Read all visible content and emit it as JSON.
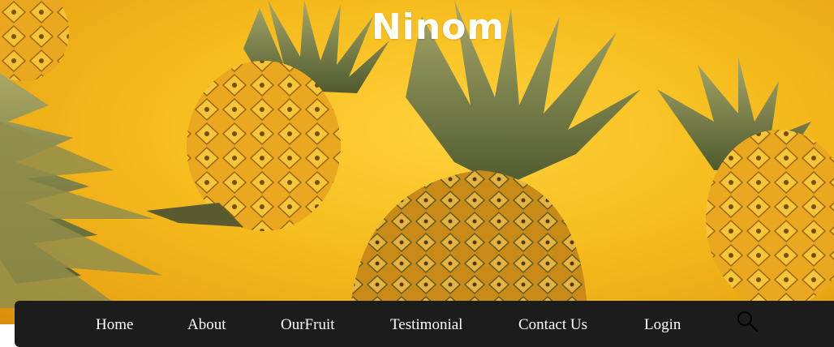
{
  "brand": {
    "title": "Ninom"
  },
  "nav": {
    "items": [
      {
        "label": "Home"
      },
      {
        "label": "About"
      },
      {
        "label": "OurFruit"
      },
      {
        "label": "Testimonial"
      },
      {
        "label": "Contact Us"
      },
      {
        "label": "Login"
      }
    ],
    "search_icon": "search-icon"
  },
  "colors": {
    "navbar_bg": "#1c1c1c",
    "hero_yellow": "#f6bd1e",
    "text_white": "#ffffff"
  }
}
